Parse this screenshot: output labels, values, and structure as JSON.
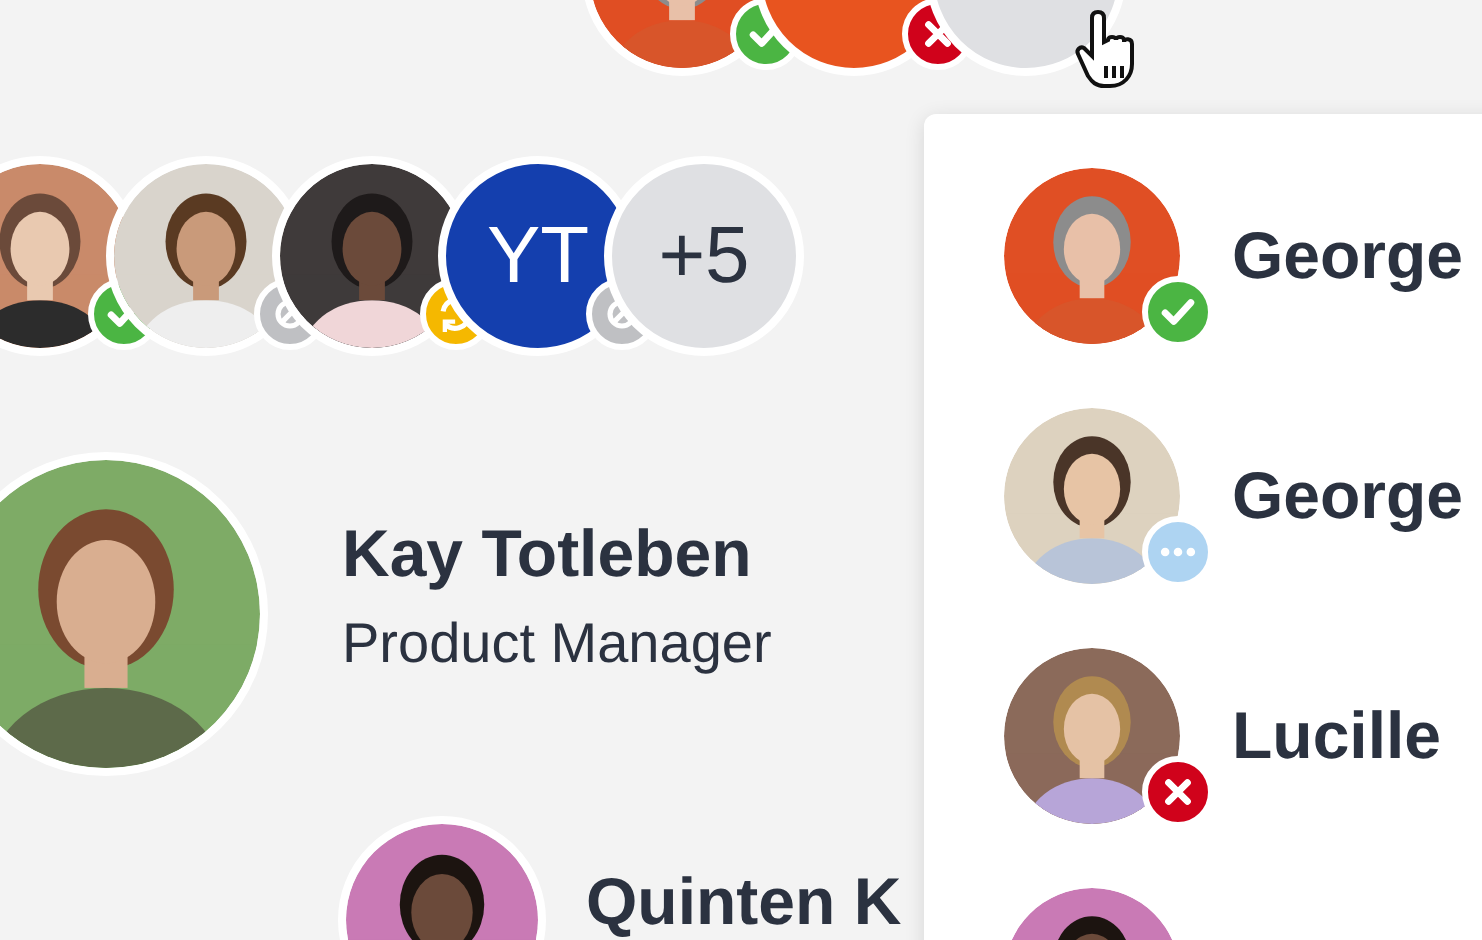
{
  "top_group": [
    {
      "kind": "picture",
      "badge": {
        "kind": "check"
      }
    },
    {
      "kind": "blank",
      "color": "#e8541f",
      "badge": {
        "kind": "cross"
      }
    },
    {
      "kind": "blank",
      "color": "#dfe0e3"
    }
  ],
  "avatar_group": [
    {
      "kind": "picture",
      "badge": {
        "kind": "check"
      }
    },
    {
      "kind": "picture",
      "badge": {
        "kind": "ban"
      }
    },
    {
      "kind": "picture",
      "badge": {
        "kind": "sync"
      }
    },
    {
      "kind": "initials",
      "color": "#143fae",
      "text": "YT",
      "badge": {
        "kind": "ban"
      }
    },
    {
      "kind": "more",
      "color": "#dfe0e3",
      "text": "+5"
    }
  ],
  "profile": {
    "name": "Kay Totleben",
    "role": "Product Manager"
  },
  "profile_2": {
    "name": "Quinten K"
  },
  "dropdown": [
    {
      "kind": "picture",
      "name": "George",
      "badge": {
        "kind": "check"
      }
    },
    {
      "kind": "picture",
      "name": "George",
      "badge": {
        "kind": "dots"
      }
    },
    {
      "kind": "picture",
      "name": "Lucille",
      "badge": {
        "kind": "cross"
      }
    },
    {
      "kind": "picture"
    }
  ]
}
